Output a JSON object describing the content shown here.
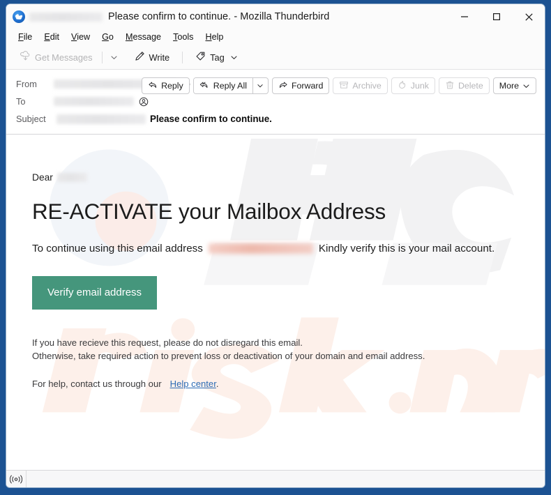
{
  "window": {
    "title": "Please confirm to continue. - Mozilla Thunderbird",
    "app_icon": "thunderbird-logo",
    "minimize_label": "Minimize",
    "maximize_label": "Maximize",
    "close_label": "Close"
  },
  "menubar": {
    "items": [
      {
        "label": "File",
        "accesskey": "F"
      },
      {
        "label": "Edit",
        "accesskey": "E"
      },
      {
        "label": "View",
        "accesskey": "V"
      },
      {
        "label": "Go",
        "accesskey": "G"
      },
      {
        "label": "Message",
        "accesskey": "M"
      },
      {
        "label": "Tools",
        "accesskey": "T"
      },
      {
        "label": "Help",
        "accesskey": "H"
      }
    ]
  },
  "toolbar": {
    "get_messages": "Get Messages",
    "get_messages_icon": "cloud-download-icon",
    "get_messages_disabled": true,
    "write": "Write",
    "write_icon": "pencil-icon",
    "tag": "Tag",
    "tag_icon": "tag-icon"
  },
  "header": {
    "from_label": "From",
    "to_label": "To",
    "subject_label": "Subject",
    "subject_text": "Please confirm to continue.",
    "from_value": "",
    "to_value": "",
    "subject_sender": "",
    "contact_icon": "contact-person-icon"
  },
  "actions": {
    "reply": "Reply",
    "reply_icon": "reply-arrow-icon",
    "reply_all": "Reply All",
    "reply_all_icon": "reply-all-arrow-icon",
    "forward": "Forward",
    "forward_icon": "forward-arrow-icon",
    "archive": "Archive",
    "archive_icon": "archive-box-icon",
    "junk": "Junk",
    "junk_icon": "junk-flame-icon",
    "delete": "Delete",
    "delete_icon": "trash-icon",
    "more": "More"
  },
  "message": {
    "greeting": "Dear",
    "headline": "RE-ACTIVATE your Mailbox Address",
    "para_before_email": "To continue using this email address",
    "para_after_email": "Kindly verify this is your mail account.",
    "cta_label": "Verify email address",
    "cta_color": "#45967c",
    "footer_line_1": "If you have recieve this request, please do not disregard this email.",
    "footer_line_2": "Otherwise, take required action to prevent loss or deactivation of your domain and email address.",
    "help_prefix": "For help, contact us through our",
    "help_link": "Help center",
    "help_suffix": ".",
    "link_color": "#2d6cb5"
  },
  "watermark": {
    "primary_text": "PC",
    "secondary_text": "risk.com"
  },
  "statusbar": {
    "icon": "broadcast-signal-icon",
    "text": ""
  }
}
